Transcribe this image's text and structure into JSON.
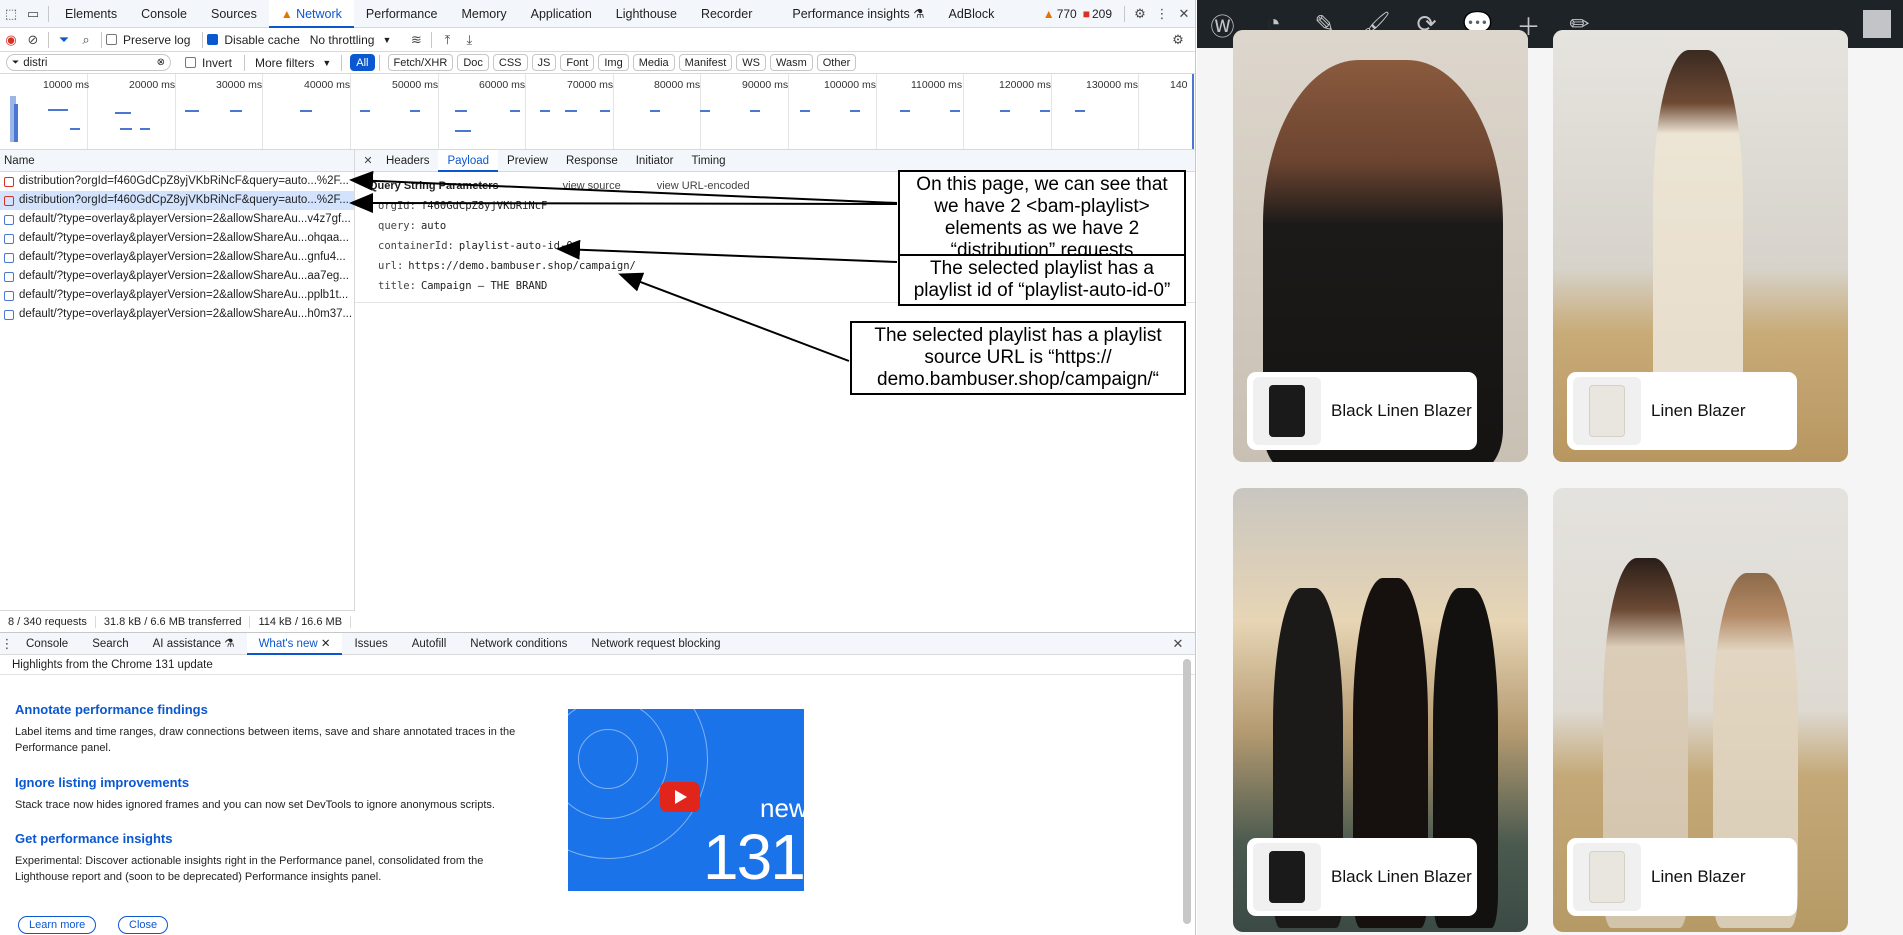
{
  "devtools": {
    "tabs": [
      "Elements",
      "Console",
      "Sources",
      "Network",
      "Performance",
      "Memory",
      "Application",
      "Lighthouse",
      "Recorder",
      "Performance insights",
      "AdBlock"
    ],
    "warnings_count": "770",
    "errors_count": "209",
    "toolbar": {
      "preserve_log": "Preserve log",
      "disable_cache": "Disable cache",
      "throttling": "No throttling"
    },
    "filter": {
      "value": "distri",
      "invert": "Invert",
      "more_filters": "More filters",
      "types": [
        "All",
        "Fetch/XHR",
        "Doc",
        "CSS",
        "JS",
        "Font",
        "Img",
        "Media",
        "Manifest",
        "WS",
        "Wasm",
        "Other"
      ]
    },
    "timeline_ticks": [
      "10000 ms",
      "20000 ms",
      "30000 ms",
      "40000 ms",
      "50000 ms",
      "60000 ms",
      "70000 ms",
      "80000 ms",
      "90000 ms",
      "100000 ms",
      "110000 ms",
      "120000 ms",
      "130000 ms",
      "140"
    ],
    "requests": {
      "column_name": "Name",
      "rows": [
        "distribution?orgId=f460GdCpZ8yjVKbRiNcF&query=auto...%2F...",
        "distribution?orgId=f460GdCpZ8yjVKbRiNcF&query=auto...%2F...",
        "default/?type=overlay&playerVersion=2&allowShareAu...v4z7gf...",
        "default/?type=overlay&playerVersion=2&allowShareAu...ohqaa...",
        "default/?type=overlay&playerVersion=2&allowShareAu...gnfu4...",
        "default/?type=overlay&playerVersion=2&allowShareAu...aa7eg...",
        "default/?type=overlay&playerVersion=2&allowShareAu...pplb1t...",
        "default/?type=overlay&playerVersion=2&allowShareAu...h0m37..."
      ]
    },
    "status": {
      "requests": "8 / 340 requests",
      "transferred": "31.8 kB / 6.6 MB transferred",
      "resources": "114 kB / 16.6 MB"
    },
    "detail": {
      "tabs": [
        "Headers",
        "Payload",
        "Preview",
        "Response",
        "Initiator",
        "Timing"
      ],
      "section_title": "Query String Parameters",
      "view_source": "view source",
      "view_url_encoded": "view URL-encoded",
      "params": [
        {
          "key": "orgId:",
          "value": "f460GdCpZ8yjVKbRiNcF"
        },
        {
          "key": "query:",
          "value": "auto"
        },
        {
          "key": "containerId:",
          "value": "playlist-auto-id-0"
        },
        {
          "key": "url:",
          "value": "https://demo.bambuser.shop/campaign/"
        },
        {
          "key": "title:",
          "value": "Campaign – THE BRAND"
        }
      ]
    },
    "drawer": {
      "tabs": [
        "Console",
        "Search",
        "AI assistance",
        "What's new",
        "Issues",
        "Autofill",
        "Network conditions",
        "Network request blocking"
      ],
      "header": "Highlights from the Chrome 131 update",
      "items": [
        {
          "title": "Annotate performance findings",
          "body": "Label items and time ranges, draw connections between items, save and share annotated traces in the Performance panel."
        },
        {
          "title": "Ignore listing improvements",
          "body": "Stack trace now hides ignored frames and you can now set DevTools to ignore anonymous scripts."
        },
        {
          "title": "Get performance insights",
          "body": "Experimental: Discover actionable insights right in the Performance panel, consolidated from the Lighthouse report and (soon to be deprecated) Performance insights panel."
        }
      ],
      "learn_more": "Learn more",
      "close": "Close",
      "banner_new": "new",
      "banner_version": "131"
    }
  },
  "annotations": {
    "distribution": "On this page, we can see that we have 2 <bam-playlist> elements as we have 2 “distribution” requests",
    "playlist_id": "The selected playlist has a playlist id of “playlist-auto-id-0”",
    "source_url": "The selected playlist has a playlist source URL is “https:// demo.bambuser.shop/campaign/“"
  },
  "site": {
    "products": [
      {
        "name": "Black Linen Blazer",
        "thumb": "black"
      },
      {
        "name": "Linen Blazer",
        "thumb": "cream"
      },
      {
        "name": "Black Linen Blazer",
        "thumb": "black"
      },
      {
        "name": "Linen Blazer",
        "thumb": "cream"
      }
    ]
  },
  "colors": {
    "accent": "#0b57d0",
    "wp_bar": "#1d2327",
    "error": "#d93025",
    "warning": "#e37400"
  }
}
